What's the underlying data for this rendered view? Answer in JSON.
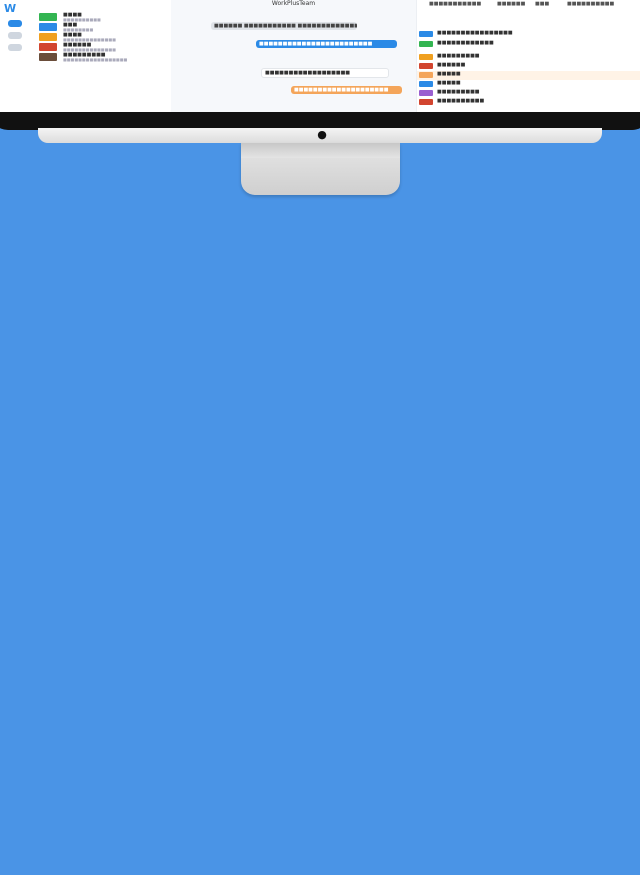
{
  "app": {
    "brand": "W",
    "window_title": "WorkPlusTeam"
  },
  "chat_list": {
    "rows": [
      {
        "name": "■■■■",
        "sub": "■■■■■■■■■■",
        "color": "#33b552"
      },
      {
        "name": "■■■",
        "sub": "■■■■■■■■",
        "color": "#2b8ae6"
      },
      {
        "name": "■■■■",
        "sub": "■■■■■■■■■■■■■■",
        "color": "#f0a020"
      },
      {
        "name": "■■■■■■",
        "sub": "■■■■■■■■■■■■■■",
        "color": "#d2452f"
      },
      {
        "name": "■■■■■■■■■",
        "sub": "■■■■■■■■■■■■■■■■■",
        "color": "#6a4d3a"
      }
    ]
  },
  "chat": {
    "bubbles": [
      {
        "text": "■■■■■■ ■■■■■■■■■■■ ■■■■■■■■■■■■■",
        "bg": "#dfe3e8",
        "color": "#444"
      },
      {
        "text": "■■■■■■■■■■■■■■■■■■■■■■■■",
        "bg": "#2b8ae6",
        "color": "#ffffff"
      },
      {
        "text": "■■■■■■■■■■■■■■■■■■",
        "bg": "#ffffff",
        "color": "#333"
      },
      {
        "text": "■■■■■■■■■■■■■■■■■■■■",
        "bg": "#f4a55a",
        "color": "#ffffff"
      }
    ]
  },
  "right_panel": {
    "tabs": [
      "■■■■■■■■",
      "■■■",
      "■■■■■■",
      "■■■",
      "■■■■■■■■■■"
    ],
    "apps": [
      {
        "name": "■■■■■■■■■■■■■■■■",
        "sub": "■■■■■■■■■■",
        "color": "#2b8ae6"
      },
      {
        "name": "■■■■■■■■■■■■",
        "sub": "■■■■",
        "color": "#33b552"
      },
      {
        "name": "■■■■■■■■■",
        "sub": "■■■■■■",
        "color": "#f0a020"
      },
      {
        "name": "■■■■■■",
        "sub": "■■■■■■■■",
        "color": "#d2452f"
      },
      {
        "name": "■■■■■",
        "sub": "■■■■■■",
        "color": "#f4a55a"
      },
      {
        "name": "■■■■■",
        "sub": "■■■■■■",
        "color": "#2b8ae6"
      },
      {
        "name": "■■■■■■■■■",
        "sub": "■■■■■■■■■■■■■■",
        "color": "#9a5fd0"
      },
      {
        "name": "■■■■■■■■■■",
        "sub": "■■■■■■■■■■■■■■■■",
        "color": "#d2452f"
      }
    ]
  },
  "colors": {
    "background": "#4a94e6",
    "accent": "#2b8ae6"
  }
}
